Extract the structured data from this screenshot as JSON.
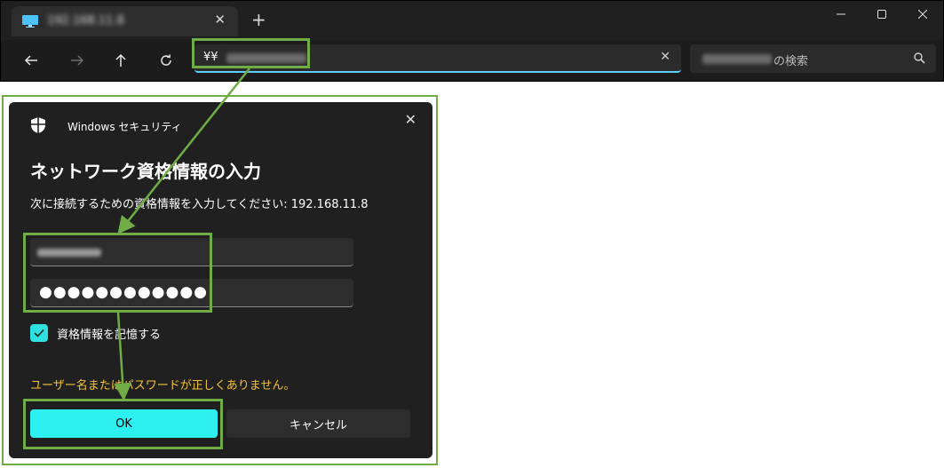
{
  "explorer": {
    "tab": {
      "title": "192.168.11.8"
    },
    "address": {
      "value": "¥¥"
    },
    "search": {
      "suffix": "の検索"
    }
  },
  "dialog": {
    "app_name": "Windows セキュリティ",
    "title": "ネットワーク資格情報の入力",
    "description": "次に接続するための資格情報を入力してください: 192.168.11.8",
    "password_mask": "●●●●●●●●●●●●",
    "remember_label": "資格情報を記憶する",
    "remember_checked": true,
    "error": "ユーザー名またはパスワードが正しくありません。",
    "ok_label": "OK",
    "cancel_label": "キャンセル"
  },
  "colors": {
    "accent": "#2ef0f0",
    "error": "#f5c23a",
    "annotation": "#70ad47",
    "dialog_bg": "#202020"
  }
}
